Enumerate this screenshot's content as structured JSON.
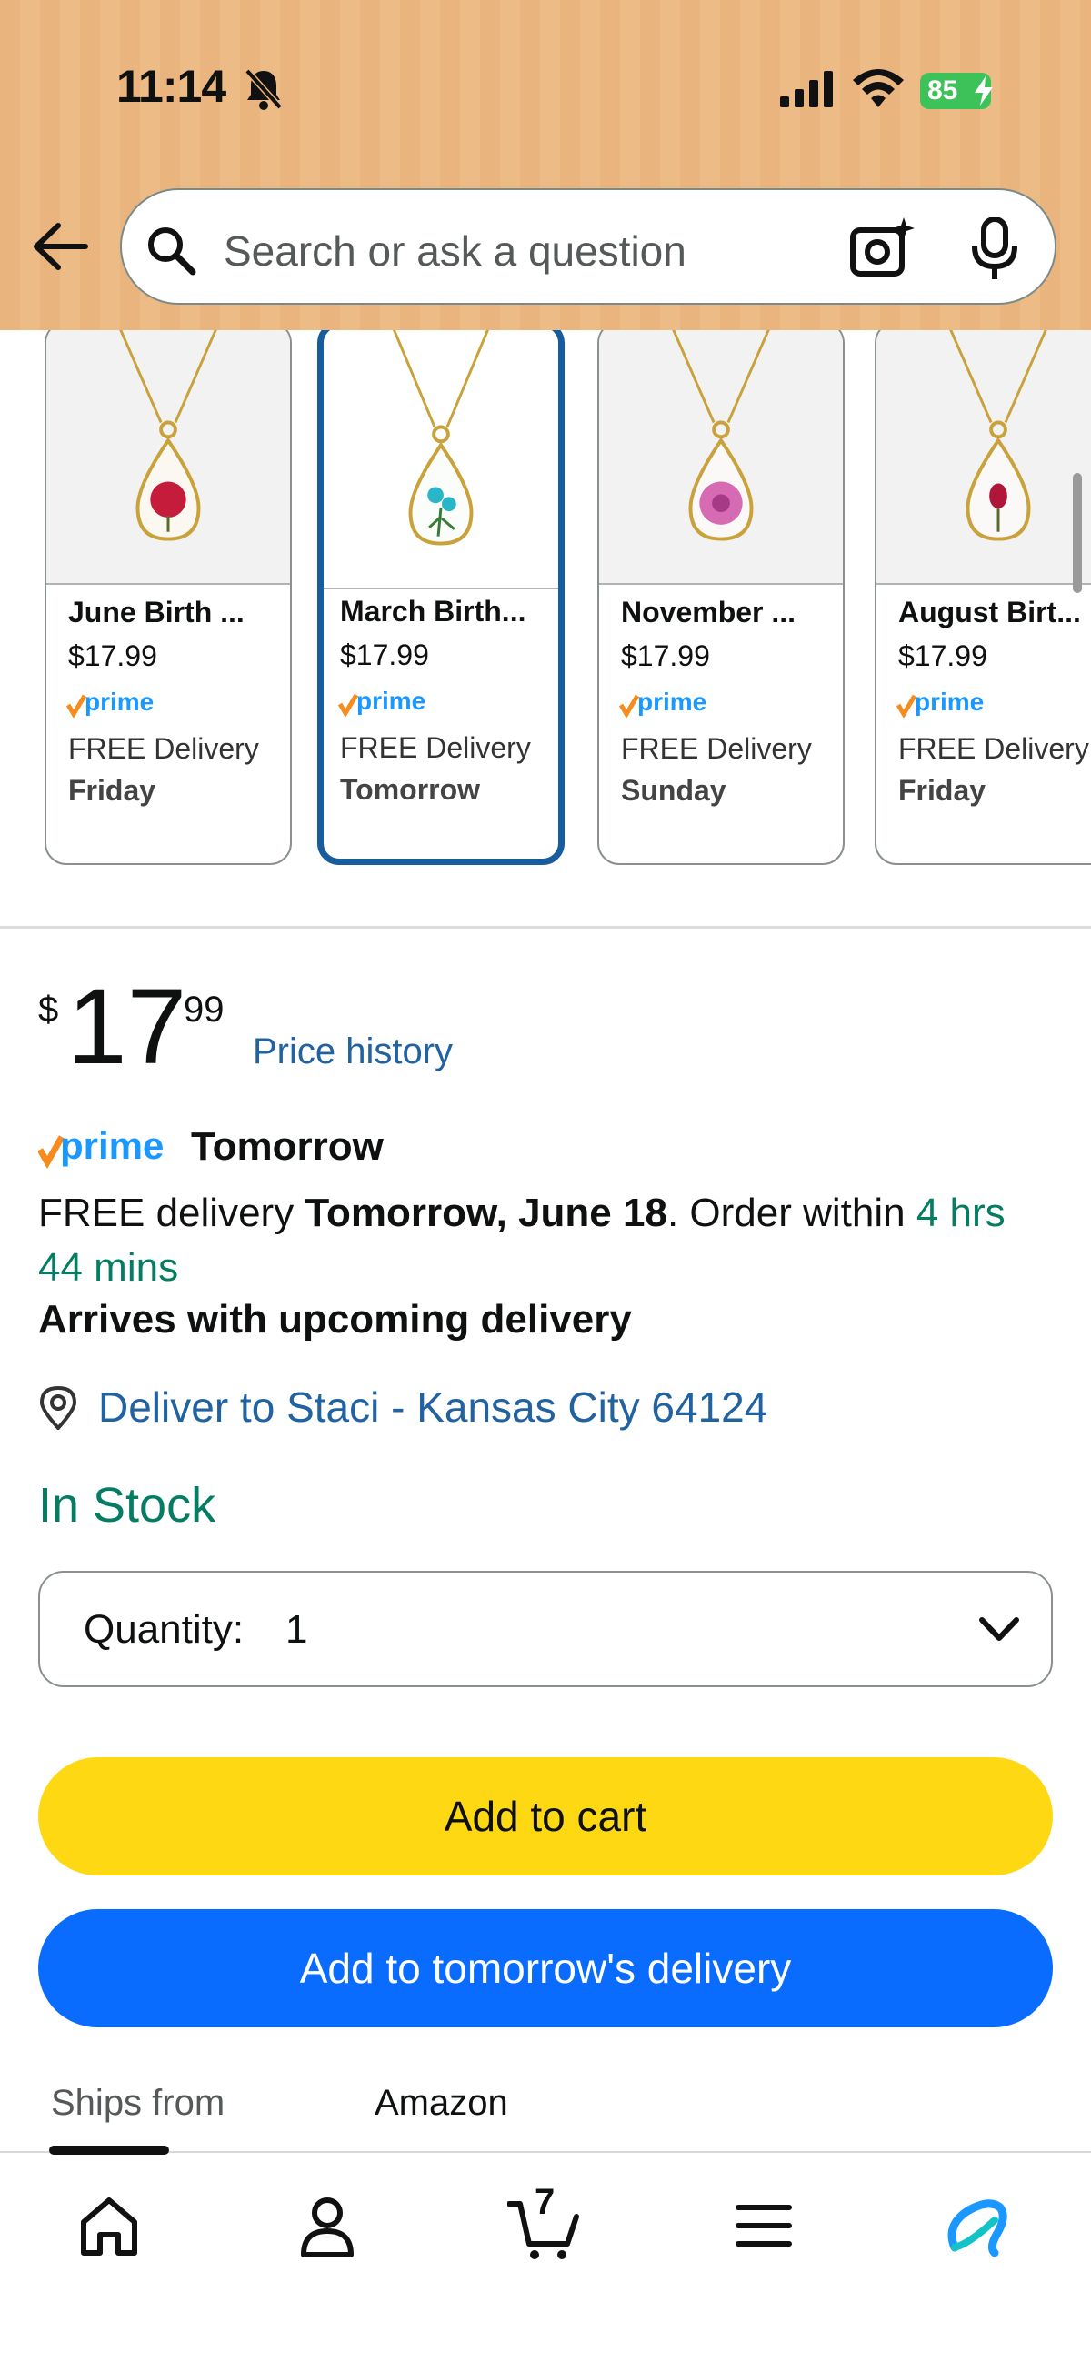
{
  "status_bar": {
    "time": "11:14",
    "battery": "85"
  },
  "header": {
    "search_placeholder": "Search or ask a question"
  },
  "carousel": {
    "items": [
      {
        "name": "June Birth ...",
        "price": "$17.99",
        "prime": "prime",
        "delivery": "FREE Delivery",
        "day": "Friday"
      },
      {
        "name": "March Birth...",
        "price": "$17.99",
        "prime": "prime",
        "delivery": "FREE Delivery",
        "day": "Tomorrow"
      },
      {
        "name": "November ...",
        "price": "$17.99",
        "prime": "prime",
        "delivery": "FREE Delivery",
        "day": "Sunday"
      },
      {
        "name": "August Birt...",
        "price": "$17.99",
        "prime": "prime",
        "delivery": "FREE Delivery",
        "day": "Friday"
      }
    ]
  },
  "price": {
    "symbol": "$",
    "whole": "17",
    "fraction": "99",
    "history_link": "Price history"
  },
  "delivery": {
    "prime_word": "prime",
    "prime_label": "Tomorrow",
    "free_prefix": "FREE delivery ",
    "date": "Tomorrow, June 18",
    "order_within_prefix": ". Order within ",
    "countdown": "4 hrs 44 mins",
    "arrives": "Arrives with upcoming delivery",
    "deliver_to": "Deliver to Staci - Kansas City 64124"
  },
  "stock": {
    "status": "In Stock"
  },
  "quantity": {
    "label": "Quantity:",
    "value": "1"
  },
  "buttons": {
    "add_to_cart": "Add to cart",
    "add_tomorrow": "Add to tomorrow's delivery"
  },
  "ships_from": {
    "label": "Ships from",
    "value": "Amazon"
  },
  "bottom_nav": {
    "cart_count": "7"
  },
  "colors": {
    "accent_blue": "#0a6cff",
    "cart_yellow": "#ffd814",
    "stock_green": "#067d62",
    "link_blue": "#2162a1"
  }
}
